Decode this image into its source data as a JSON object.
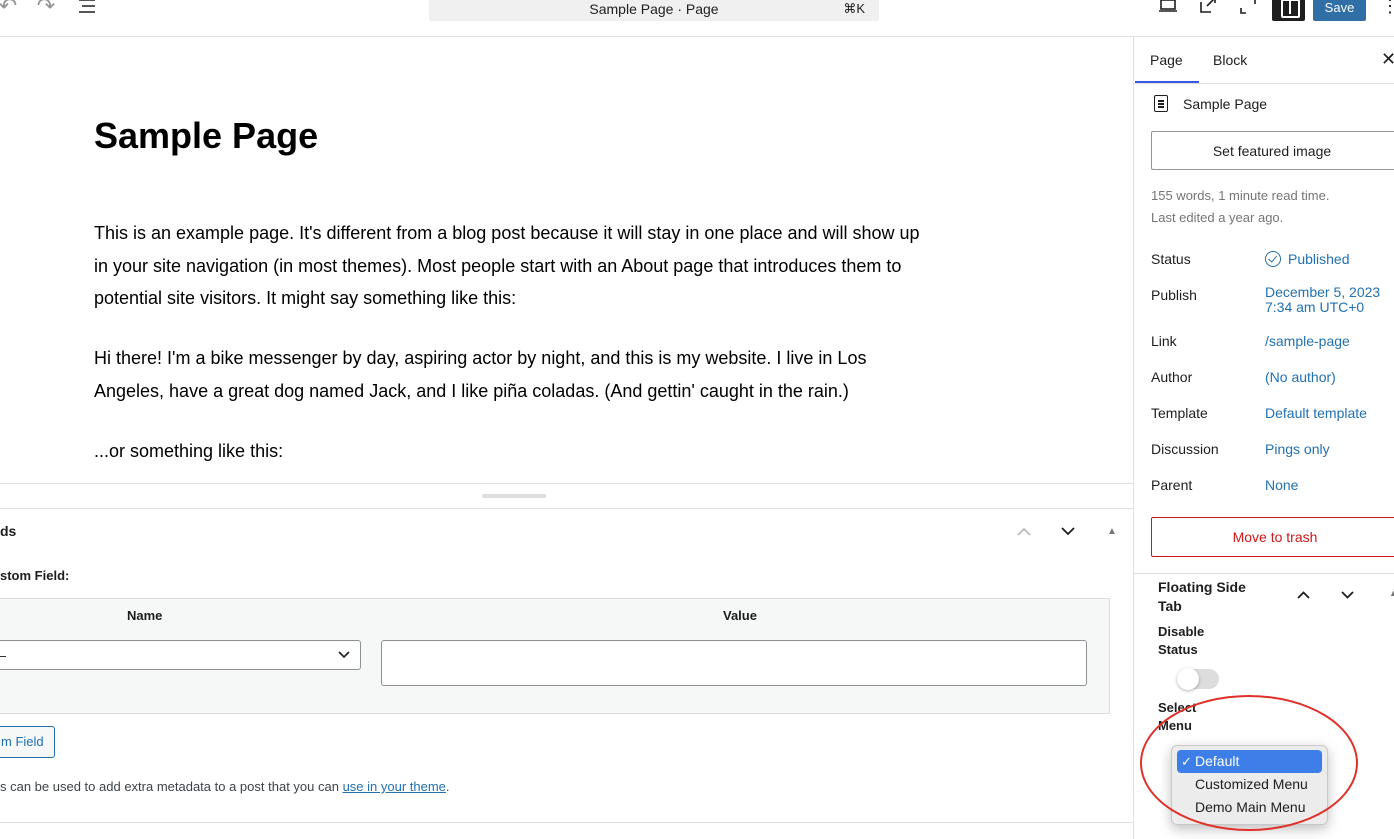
{
  "toolbar": {
    "command_title": "Sample Page · Page",
    "command_shortcut": "⌘K",
    "save_label": "Save"
  },
  "editor": {
    "title": "Sample Page",
    "paragraphs": [
      "This is an example page. It's different from a blog post because it will stay in one place and will show up in your site navigation (in most themes). Most people start with an About page that introduces them to potential site visitors. It might say something like this:",
      "Hi there! I'm a bike messenger by day, aspiring actor by night, and this is my website. I live in Los Angeles, have a great dog named Jack, and I like piña coladas. (And gettin' caught in the rain.)",
      "...or something like this:"
    ]
  },
  "meta_box": {
    "title": "ds",
    "add_label": "stom Field:",
    "col_name": "Name",
    "col_value": "Value",
    "select_value": "—",
    "add_button": "m Field",
    "note_text": "s can be used to add extra metadata to a post that you can ",
    "note_link": "use in your theme",
    "note_end": "."
  },
  "sidebar": {
    "tab_page": "Page",
    "tab_block": "Block",
    "doc_title": "Sample Page",
    "featured_image_button": "Set featured image",
    "word_count": "155 words, 1 minute read time.",
    "last_edited": "Last edited a year ago.",
    "status_label": "Status",
    "status_value": "Published",
    "publish_label": "Publish",
    "publish_value_line1": "December 5, 2023",
    "publish_value_line2": "7:34 am UTC+0",
    "link_label": "Link",
    "link_value": "/sample-page",
    "author_label": "Author",
    "author_value": "(No author)",
    "template_label": "Template",
    "template_value": "Default template",
    "discussion_label": "Discussion",
    "discussion_value": "Pings only",
    "parent_label": "Parent",
    "parent_value": "None",
    "trash_button": "Move to trash",
    "floating_title": "Floating Side Tab",
    "disable_status_label": "Disable Status",
    "disable_status_on": false,
    "select_menu_label": "Select Menu"
  },
  "dropdown": {
    "options": [
      "Default",
      "Customized Menu",
      "Demo Main Menu"
    ],
    "selected_index": 0
  },
  "colors": {
    "accent": "#2271b1",
    "danger": "#cc1818",
    "annotation": "#e0302a"
  }
}
